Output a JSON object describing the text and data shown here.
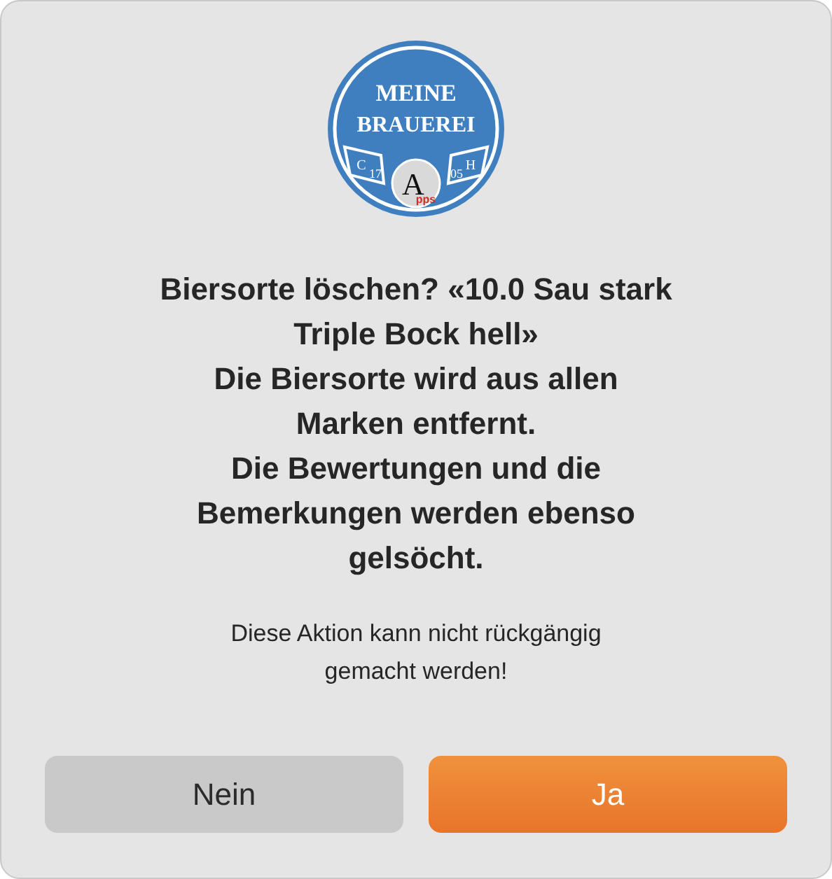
{
  "logo": {
    "line_1": "MEINE",
    "line_2": "BRAUEREI",
    "left_tab": "C",
    "left_year": "17",
    "right_year": "05",
    "right_tab": "H",
    "badge_letter": "A",
    "badge_text": "pps"
  },
  "title_lines": [
    "Biersorte löschen? «10.0 Sau stark",
    "Triple Bock hell»",
    "Die Biersorte wird aus allen",
    "Marken entfernt.",
    "Die Bewertungen und die",
    "Bemerkungen werden ebenso",
    "gelsöcht."
  ],
  "message_lines": [
    "Diese Aktion kann nicht rückgängig",
    "gemacht werden!"
  ],
  "buttons": [
    {
      "label": "Nein",
      "kind": "secondary"
    },
    {
      "label": "Ja",
      "kind": "primary"
    }
  ]
}
